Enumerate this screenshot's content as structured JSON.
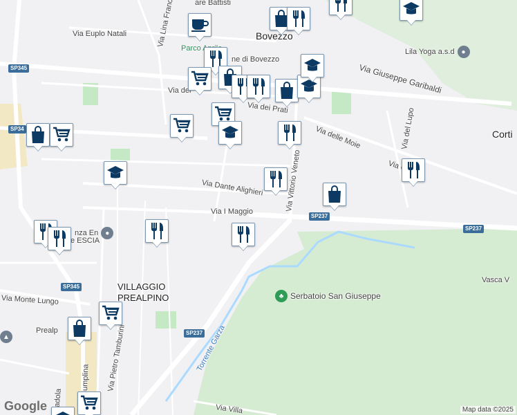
{
  "map": {
    "labels": {
      "cesare_battisti": "are Battisti",
      "bovezzo": "Bovezzo",
      "via_euplo_natali": "Via Euplo Natali",
      "via_lina_franc": "Via Lina Franc",
      "parco": "Parco Aprile",
      "comune": "ne di Bovezzo",
      "lila_yoga": "Lila Yoga a.s.d",
      "via_garibaldi": "Via Giuseppe Garibaldi",
      "corti": "Corti",
      "via_dei_prati": "Via dei Prati",
      "via_dei": "Via dei",
      "via_delle_moie": "Via delle Moie",
      "via_del_lupo": "Via del Lupo",
      "via_c": "Via C",
      "via_dante": "Via Dante Alighieri",
      "via_vittorio_veneto": "Via Vittorio Veneto",
      "via_i_maggio": "Via I Maggio",
      "nza_en": "nza En",
      "de_brescia": "De  ESCIA",
      "villaggio": "VILLAGGIO",
      "prealpino": "PREALPINO",
      "via_monte_lungo": "Via Monte Lungo",
      "prealp": "Prealp",
      "via_triumplina": "Via Triumplina",
      "via_pietro_tamburini": "Via Pietro Tamburini",
      "serbatoio": "Serbatoio San Giuseppe",
      "torrente_garza": "Torrente Garza",
      "vasca": "Vasca V",
      "via_villa": "Via Villa",
      "badola": "Badola"
    },
    "shields": {
      "sp345_a": "SP345",
      "sp345_b": "SP34",
      "sp345_c": "SP345",
      "sp237_a": "SP237",
      "sp237_b": "SP237",
      "sp237_c": "SP237"
    },
    "attribution": "Map data ©2025",
    "logo": "Google",
    "colors": {
      "marker_icon": "#0d3a63",
      "water": "#aadaff",
      "park": "#c5e8c5",
      "road": "#ffffff"
    }
  }
}
